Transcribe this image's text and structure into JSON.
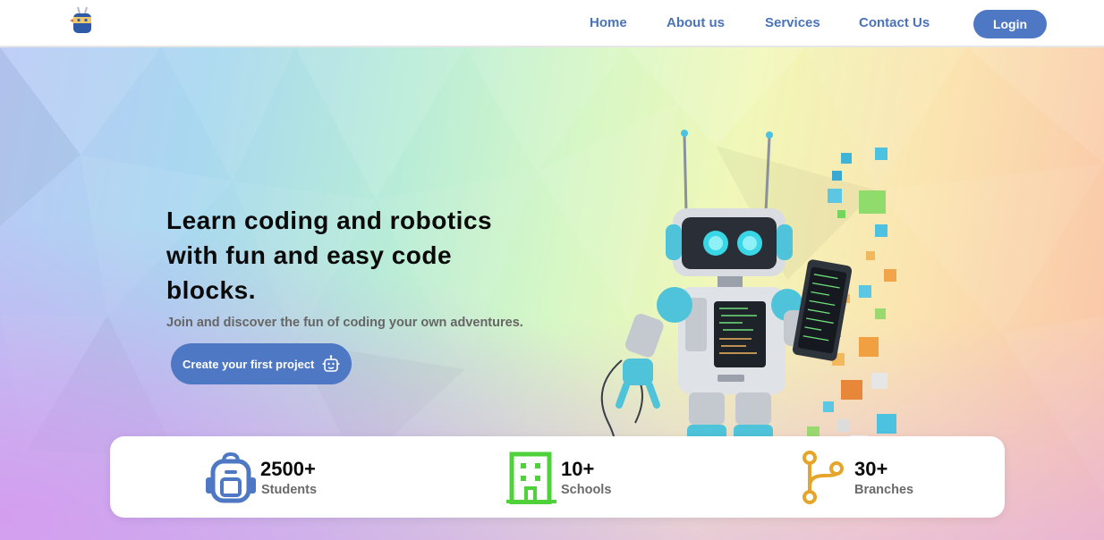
{
  "nav": {
    "items": [
      {
        "label": "Home"
      },
      {
        "label": "About us"
      },
      {
        "label": "Services"
      },
      {
        "label": "Contact Us"
      }
    ],
    "login_label": "Login"
  },
  "hero": {
    "title_lines": [
      "Learn coding and robotics",
      "with fun and easy code",
      "blocks."
    ],
    "subtitle": "Join and discover the fun of coding your own adventures.",
    "cta_label": "Create your first project"
  },
  "stats": [
    {
      "value": "2500+",
      "label": "Students",
      "icon": "backpack-icon",
      "color": "#4f78c4"
    },
    {
      "value": "10+",
      "label": "Schools",
      "icon": "building-icon",
      "color": "#4fd13a"
    },
    {
      "value": "30+",
      "label": "Branches",
      "icon": "branch-icon",
      "color": "#e5a42a"
    }
  ],
  "colors": {
    "accent": "#4f78c4",
    "nav_text": "#4a73b8"
  }
}
